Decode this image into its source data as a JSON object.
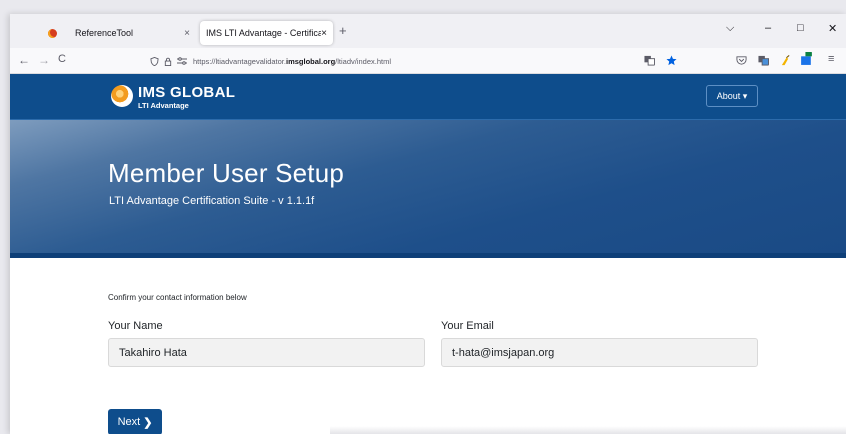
{
  "browser": {
    "tabs": [
      {
        "title": "ReferenceTool",
        "close": "×"
      },
      {
        "title": "IMS LTI Advantage - Certification S…",
        "close": "×"
      }
    ],
    "new_tab": "+",
    "window_controls": {
      "list": "⌵",
      "minimize": "–",
      "maximize": "□",
      "close": "✕"
    },
    "nav": {
      "back": "←",
      "forward": "→",
      "reload": "C"
    },
    "url_prefix": "https://ltiadvantagevalidator.",
    "url_domain": "imsglobal.org",
    "url_path": "/ltiadv/index.html"
  },
  "site": {
    "brand": "IMS GLOBAL",
    "brand_sub": "LTI Advantage",
    "about_label": "About ▾"
  },
  "page": {
    "title": "Member User Setup",
    "subtitle": "LTI Advantage Certification Suite - v 1.1.1f",
    "instruction": "Confirm your contact information below",
    "name_label": "Your Name",
    "name_value": "Takahiro Hata",
    "email_label": "Your Email",
    "email_value": "t-hata@imsjapan.org",
    "next_label": "Next",
    "next_chevron": "❯"
  },
  "colors": {
    "header_blue": "#0e4d8c",
    "button_blue": "#0e4d8c"
  }
}
